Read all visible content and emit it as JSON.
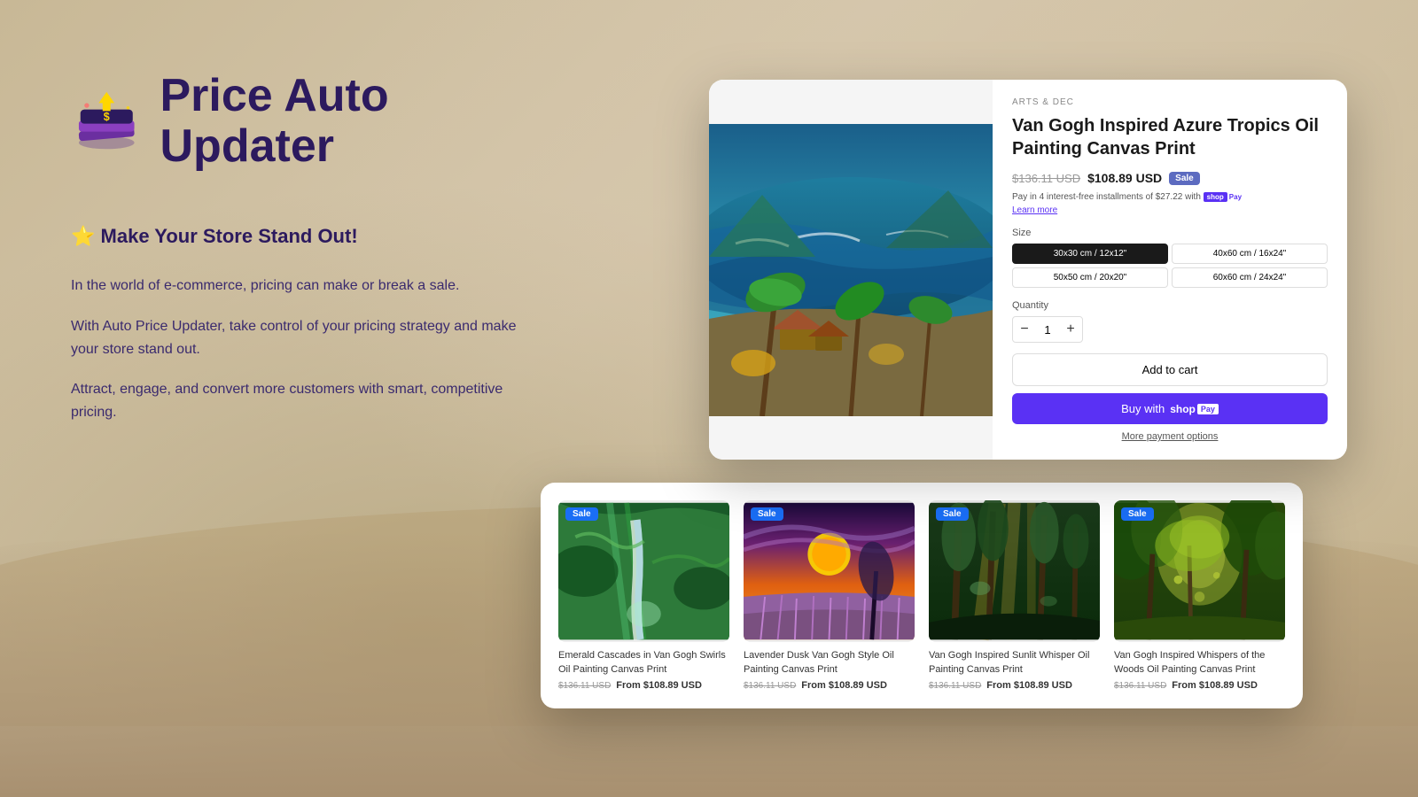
{
  "app": {
    "title": "Price Auto Updater",
    "logo_alt": "Price Auto Updater logo"
  },
  "hero": {
    "tagline": "Make Your Store Stand Out!",
    "tagline_emoji": "⭐",
    "paragraph1": "In the world of e-commerce, pricing can make or break a sale.",
    "paragraph2": "With Auto Price Updater, take control of your pricing strategy and make your store stand out.",
    "paragraph3": "Attract, engage, and convert more customers with smart, competitive pricing."
  },
  "product_detail": {
    "category": "ARTS & DEC",
    "name": "Van Gogh Inspired Azure Tropics Oil Painting Canvas Print",
    "original_price": "$136.11 USD",
    "sale_price": "$108.89 USD",
    "sale_badge": "Sale",
    "installment_text": "Pay in 4 interest-free installments of $27.22 with",
    "learn_more": "Learn more",
    "size_label": "Size",
    "sizes": [
      {
        "label": "30x30 cm / 12x12\"",
        "active": true
      },
      {
        "label": "40x60 cm / 16x24\"",
        "active": false
      },
      {
        "label": "50x50 cm / 20x20\"",
        "active": false
      },
      {
        "label": "60x60 cm / 24x24\"",
        "active": false
      }
    ],
    "quantity_label": "Quantity",
    "quantity_value": "1",
    "add_to_cart": "Add to cart",
    "buy_with_shop_pay": "Buy with",
    "more_payment_options": "More payment options"
  },
  "product_grid": {
    "items": [
      {
        "name": "Emerald Cascades in Van Gogh Swirls Oil Painting Canvas Print",
        "original_price": "$136.11 USD",
        "sale_price": "From $108.89 USD",
        "sale_badge": "Sale"
      },
      {
        "name": "Lavender Dusk Van Gogh Style Oil Painting Canvas Print",
        "original_price": "$136.11 USD",
        "sale_price": "From $108.89 USD",
        "sale_badge": "Sale"
      },
      {
        "name": "Van Gogh Inspired Sunlit Whisper Oil Painting Canvas Print",
        "original_price": "$136.11 USD",
        "sale_price": "From $108.89 USD",
        "sale_badge": "Sale"
      },
      {
        "name": "Van Gogh Inspired Whispers of the Woods Oil Painting Canvas Print",
        "original_price": "$136.11 USD",
        "sale_price": "From $108.89 USD",
        "sale_badge": "Sale"
      }
    ]
  },
  "colors": {
    "accent_purple": "#2c1a5e",
    "shop_pay_purple": "#5a31f4",
    "sale_blue": "#1a6ef5",
    "bg_tan": "#c9b89a"
  }
}
